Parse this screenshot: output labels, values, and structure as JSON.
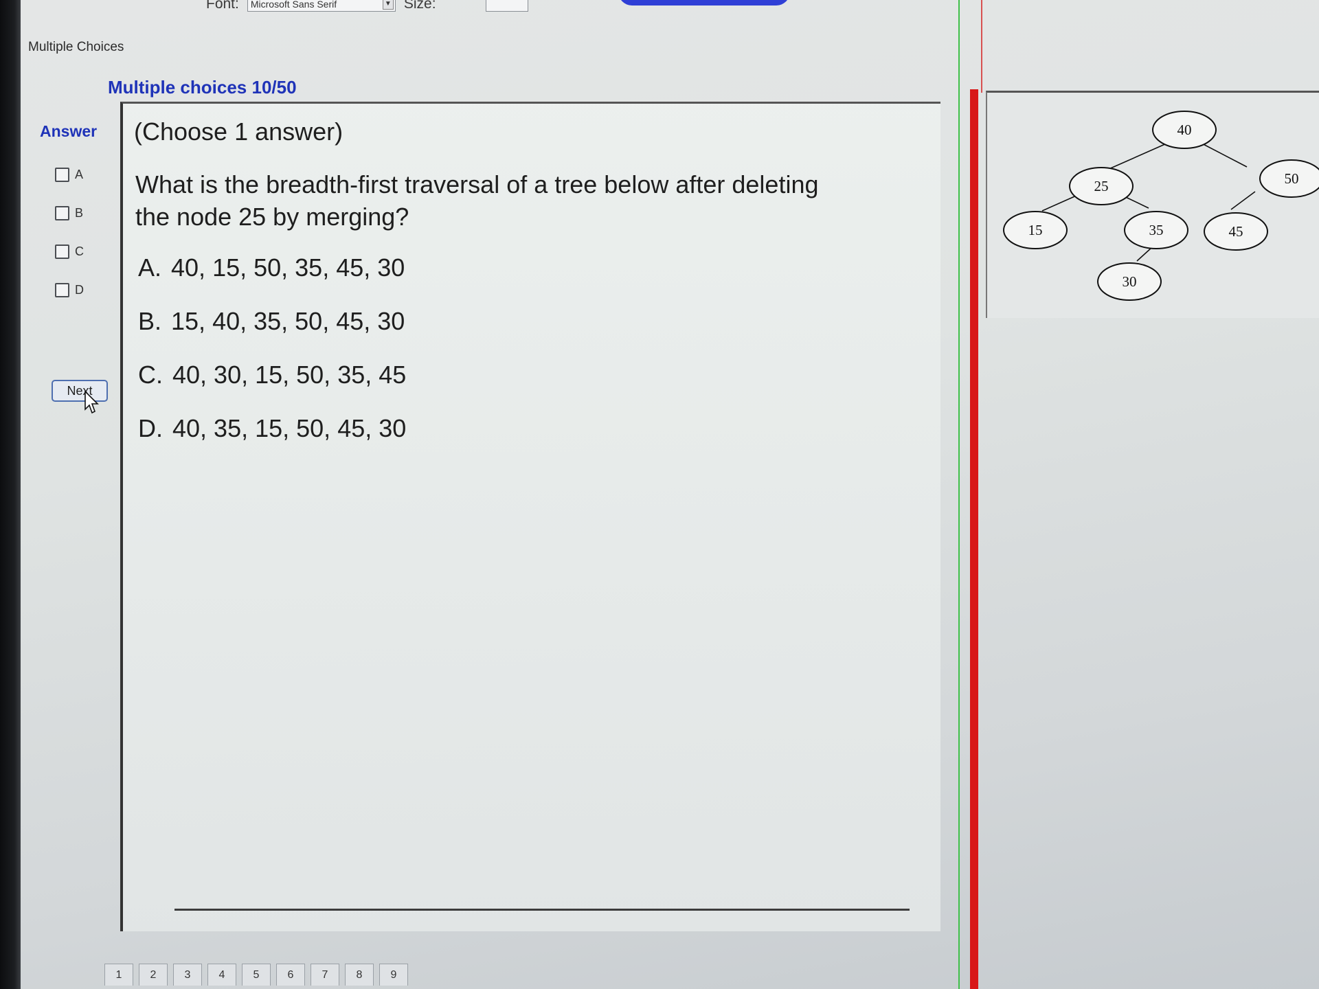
{
  "toolbar": {
    "font_label": "Font:",
    "font_value": "Microsoft Sans Serif",
    "size_label": "Size:"
  },
  "app": {
    "section_label": "Multiple Choices"
  },
  "header": {
    "title": "Multiple choices 10/50"
  },
  "answer_panel": {
    "heading": "Answer",
    "choices": [
      {
        "label": "A",
        "checked": false
      },
      {
        "label": "B",
        "checked": false
      },
      {
        "label": "C",
        "checked": false
      },
      {
        "label": "D",
        "checked": false
      }
    ],
    "next_label": "Next"
  },
  "question": {
    "instruction": "(Choose 1 answer)",
    "text": "What is the breadth-first traversal of a tree below after deleting the node  25  by merging?",
    "options": [
      {
        "letter": "A.",
        "text": "40, 15, 50, 35, 45, 30"
      },
      {
        "letter": "B.",
        "text": "15, 40, 35, 50, 45, 30"
      },
      {
        "letter": "C.",
        "text": "40, 30, 15, 50, 35, 45"
      },
      {
        "letter": "D.",
        "text": "40, 35, 15, 50, 45, 30"
      }
    ]
  },
  "tree": {
    "nodes": [
      {
        "id": "n40",
        "label": "40"
      },
      {
        "id": "n25",
        "label": "25"
      },
      {
        "id": "n50",
        "label": "50"
      },
      {
        "id": "n15",
        "label": "15"
      },
      {
        "id": "n35",
        "label": "35"
      },
      {
        "id": "n45",
        "label": "45"
      },
      {
        "id": "n30",
        "label": "30"
      }
    ],
    "edges": [
      [
        "n40",
        "n25"
      ],
      [
        "n40",
        "n50"
      ],
      [
        "n25",
        "n15"
      ],
      [
        "n25",
        "n35"
      ],
      [
        "n50",
        "n45"
      ],
      [
        "n35",
        "n30"
      ]
    ]
  },
  "pagination": {
    "pages": [
      "1",
      "2",
      "3",
      "4",
      "5",
      "6",
      "7",
      "8",
      "9"
    ]
  },
  "colors": {
    "title_blue": "#1f33b8",
    "divider_red": "#d81818",
    "guide_green": "#3fc04a"
  }
}
